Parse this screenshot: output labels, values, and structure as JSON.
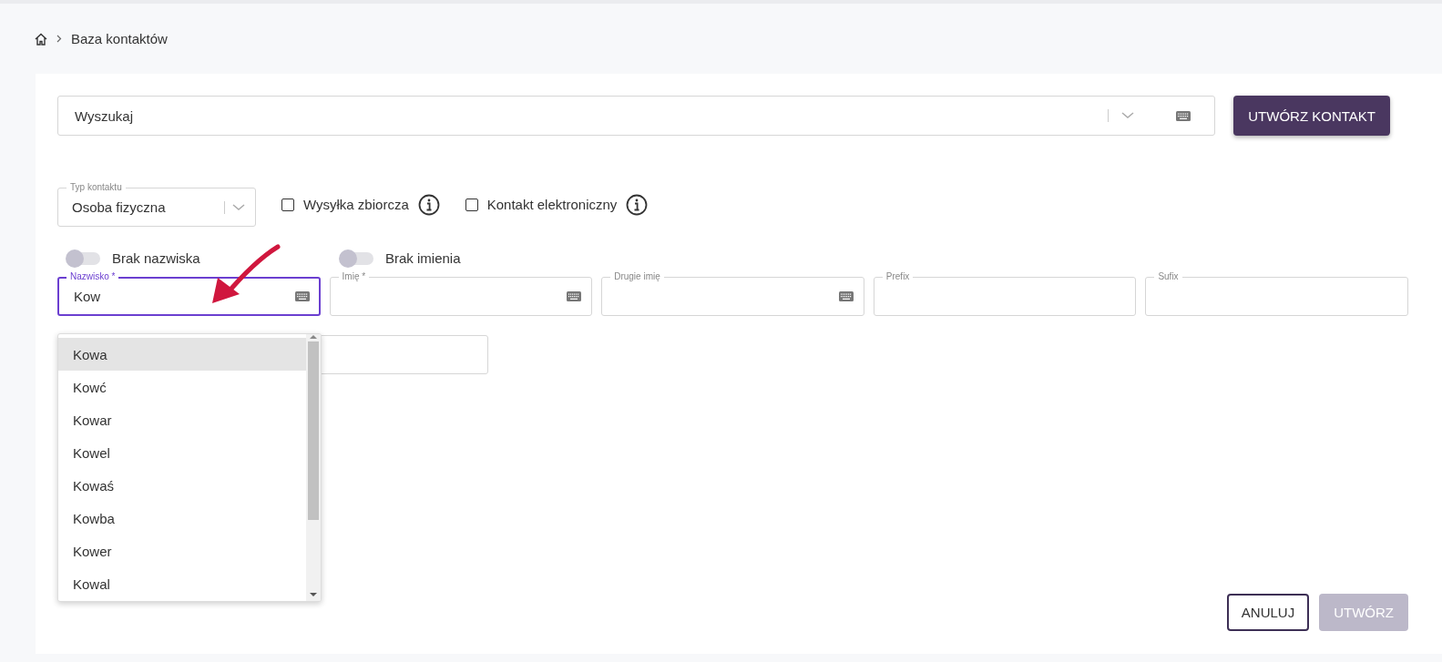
{
  "breadcrumb": {
    "current": "Baza kontaktów"
  },
  "search": {
    "placeholder": "Wyszukaj"
  },
  "create_contact_button": "UTWÓRZ KONTAKT",
  "contact_type": {
    "label": "Typ kontaktu",
    "value": "Osoba fizyczna"
  },
  "checkboxes": [
    {
      "label": "Wysyłka zbiorcza",
      "checked": false
    },
    {
      "label": "Kontakt elektroniczny",
      "checked": false
    }
  ],
  "toggles": [
    {
      "label": "Brak nazwiska",
      "on": false
    },
    {
      "label": "Brak imienia",
      "on": false
    }
  ],
  "fields": [
    {
      "label": "Nazwisko *",
      "value": "Kow",
      "focused": true,
      "keyboard": true
    },
    {
      "label": "Imię *",
      "focused": false,
      "keyboard": true
    },
    {
      "label": "Drugie imię",
      "focused": false,
      "keyboard": true
    },
    {
      "label": "Prefix",
      "focused": false,
      "keyboard": false
    },
    {
      "label": "Sufix",
      "focused": false,
      "keyboard": false
    }
  ],
  "suggestions": [
    {
      "label": "Kowa",
      "selected": true
    },
    {
      "label": "Kowć",
      "selected": false
    },
    {
      "label": "Kowar",
      "selected": false
    },
    {
      "label": "Kowel",
      "selected": false
    },
    {
      "label": "Kowaś",
      "selected": false
    },
    {
      "label": "Kowba",
      "selected": false
    },
    {
      "label": "Kower",
      "selected": false
    },
    {
      "label": "Kowal",
      "selected": false
    }
  ],
  "footer_buttons": [
    {
      "label": "ANULUJ",
      "kind": "outline",
      "disabled": false
    },
    {
      "label": "UTWÓRZ",
      "kind": "primary",
      "disabled": true
    }
  ]
}
